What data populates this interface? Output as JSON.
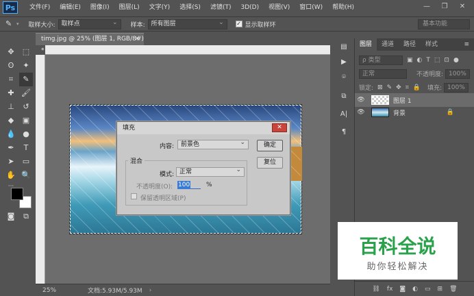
{
  "app": {
    "logo": "Ps"
  },
  "menu": [
    "文件(F)",
    "编辑(E)",
    "图像(I)",
    "图层(L)",
    "文字(Y)",
    "选择(S)",
    "滤镜(T)",
    "3D(D)",
    "视图(V)",
    "窗口(W)",
    "帮助(H)"
  ],
  "window_controls": {
    "minimize": "—",
    "restore": "❐",
    "close": "✕"
  },
  "options": {
    "sample_size_label": "取样大小:",
    "sample_size_value": "取样点",
    "sample_label": "样本:",
    "sample_value": "所有图层",
    "show_ring_label": "显示取样环",
    "show_ring_checked": true,
    "workspace": "基本功能"
  },
  "document": {
    "tab_title": "timg.jpg @ 25% (图层 1, RGB/8#) *",
    "zoom": "25%",
    "doc_size": "文档:5.93M/5.93M"
  },
  "panel": {
    "tabs": [
      "图层",
      "通道",
      "路径",
      "样式"
    ],
    "kind_filter": "ρ 类型",
    "blend_mode": "正常",
    "opacity_label": "不透明度:",
    "opacity_value": "100%",
    "lock_label": "锁定:",
    "fill_label": "填充:",
    "fill_value": "100%",
    "layers": [
      {
        "name": "图层 1",
        "selected": true
      },
      {
        "name": "背景",
        "selected": false,
        "locked": true
      }
    ]
  },
  "dialog": {
    "title": "填充",
    "content_label": "内容:",
    "content_value": "前景色",
    "ok": "确定",
    "reset": "复位",
    "blend_group": "混合",
    "mode_label": "模式:",
    "mode_value": "正常",
    "opacity_label": "不透明度(O):",
    "opacity_value": "100",
    "opacity_unit": "%",
    "preserve_label": "保留透明区域(P)",
    "preserve_checked": false
  },
  "watermark": {
    "title": "百科全说",
    "subtitle": "助你轻松解决"
  }
}
